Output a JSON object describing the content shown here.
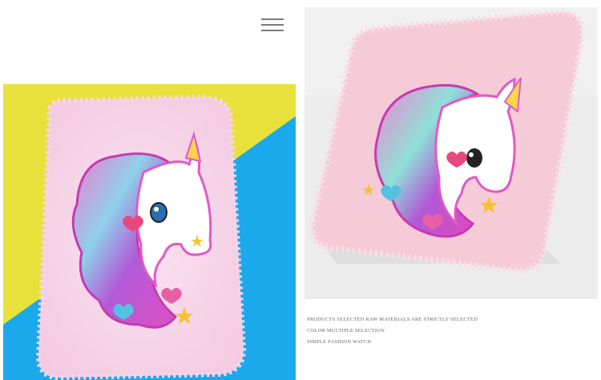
{
  "header": {
    "menu_icon": "hamburger-menu-icon"
  },
  "gallery": {
    "left_photo": {
      "subject": "pink plush unicorn notebook",
      "background_colors": [
        "#e8e23a",
        "#19a9ea"
      ]
    },
    "right_photo": {
      "subject": "pink plush unicorn notebook",
      "background_color": "#ececec"
    }
  },
  "captions": [
    "PRODUCTS SELECTED RAW MATERIALS ARE STRICTLY SELECTED",
    "COLOR MULTIPLE SELECTION",
    "SIMPLE FASHION WATCH"
  ]
}
